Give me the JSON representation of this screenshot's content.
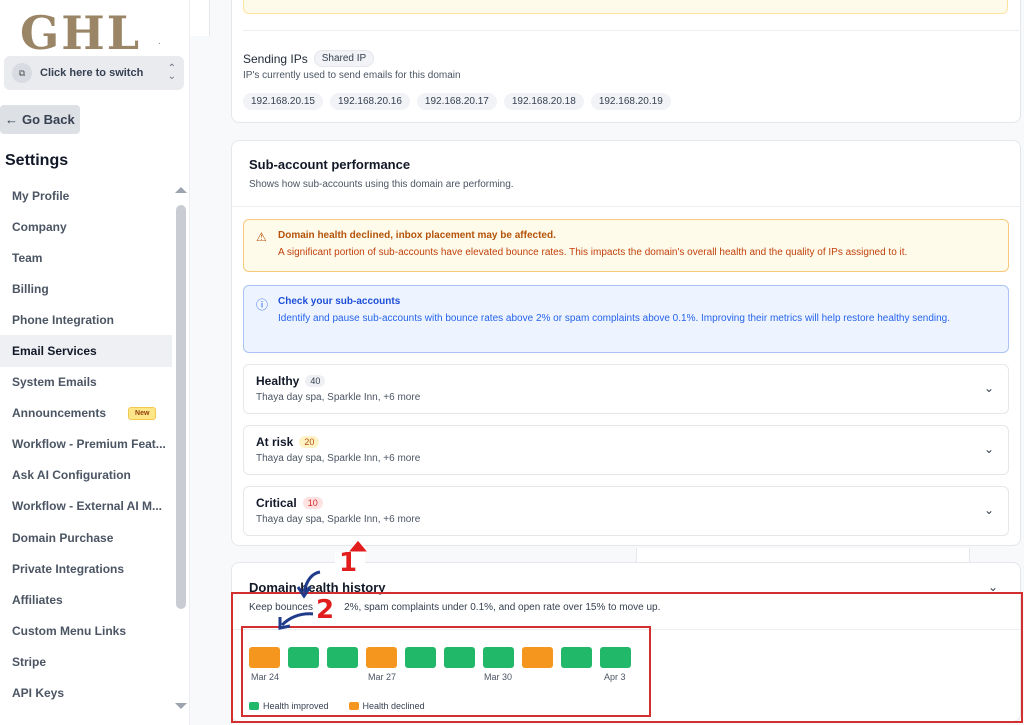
{
  "sidebar": {
    "logo": "GHL",
    "logo_dot": ".",
    "switcher_label": "Click here to switch",
    "go_back": "Go Back",
    "settings_title": "Settings",
    "items": [
      {
        "label": "My Profile"
      },
      {
        "label": "Company"
      },
      {
        "label": "Team"
      },
      {
        "label": "Billing"
      },
      {
        "label": "Phone Integration"
      },
      {
        "label": "Email Services",
        "active": true
      },
      {
        "label": "System Emails"
      },
      {
        "label": "Announcements",
        "badge": "New"
      },
      {
        "label": "Workflow - Premium Feat..."
      },
      {
        "label": "Ask AI Configuration"
      },
      {
        "label": "Workflow - External AI M..."
      },
      {
        "label": "Domain Purchase"
      },
      {
        "label": "Private Integrations"
      },
      {
        "label": "Affiliates"
      },
      {
        "label": "Custom Menu Links"
      },
      {
        "label": "Stripe"
      },
      {
        "label": "API Keys"
      }
    ]
  },
  "sending_ips": {
    "title": "Sending IPs",
    "badge": "Shared IP",
    "subtitle": "IP's currently used to send emails for this domain",
    "ips": [
      "192.168.20.15",
      "192.168.20.16",
      "192.168.20.17",
      "192.168.20.18",
      "192.168.20.19"
    ]
  },
  "performance": {
    "title": "Sub-account performance",
    "subtitle": "Shows how sub-accounts using this domain are performing.",
    "warning": {
      "title": "Domain health declined, inbox placement may be affected.",
      "body": "A significant portion of sub-accounts have elevated bounce rates. This impacts the domain's overall health and the quality of IPs assigned to it."
    },
    "info": {
      "title": "Check your sub-accounts",
      "body": "Identify and pause sub-accounts with bounce rates above 2% or spam complaints above 0.1%. Improving their metrics will help restore healthy sending."
    },
    "groups": [
      {
        "title": "Healthy",
        "count": "40",
        "accounts": "Thaya day spa, Sparkle Inn, +6 more"
      },
      {
        "title": "At risk",
        "count": "20",
        "accounts": "Thaya day spa, Sparkle Inn, +6 more"
      },
      {
        "title": "Critical",
        "count": "10",
        "accounts": "Thaya day spa, Sparkle Inn, +6 more"
      }
    ]
  },
  "history": {
    "title": "Domain health history",
    "subtitle": "Keep bounces under 2%, spam complaints under 0.1%, and open rate over 15% to move up.",
    "days": [
      "declined",
      "improved",
      "improved",
      "declined",
      "improved",
      "improved",
      "improved",
      "declined",
      "improved",
      "improved"
    ],
    "date_labels": [
      "Mar 24",
      "Mar 27",
      "Mar 30",
      "Apr 3"
    ],
    "legend": {
      "improved": "Health improved",
      "declined": "Health declined"
    },
    "colors": {
      "improved": "#22b86a",
      "declined": "#f5961e"
    }
  },
  "annotations": {
    "marker_1": "1",
    "marker_2": "2"
  }
}
